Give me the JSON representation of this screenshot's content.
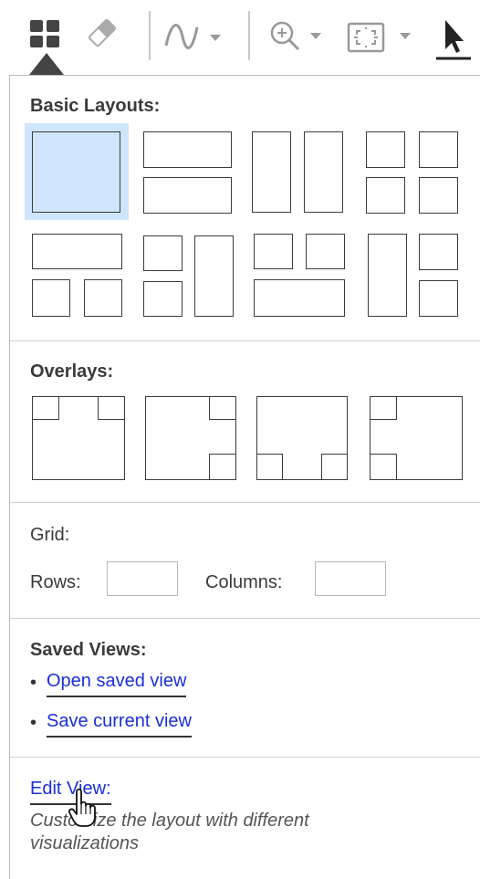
{
  "toolbar": {
    "buttons": [
      {
        "name": "layout-icon",
        "has_dropdown_pointer": true,
        "active": true
      },
      {
        "name": "eraser-icon"
      },
      {
        "name": "waveform-icon",
        "has_dropdown": true
      },
      {
        "name": "zoom-in-icon",
        "has_dropdown": true
      },
      {
        "name": "fit-view-icon",
        "has_dropdown": true
      },
      {
        "name": "select-arrow-icon"
      }
    ]
  },
  "panel": {
    "basic_layouts": {
      "heading": "Basic Layouts:"
    },
    "overlays": {
      "heading": "Overlays:"
    },
    "grid": {
      "heading": "Grid:",
      "rows_label": "Rows:",
      "columns_label": "Columns:",
      "rows_value": "",
      "columns_value": ""
    },
    "saved_views": {
      "heading": "Saved Views:",
      "bullet": "•",
      "open_label": "Open saved view",
      "save_label": "Save current view"
    },
    "edit_view": {
      "link_label": "Edit View:",
      "description": "Customize the layout with different visualizations"
    }
  },
  "colors": {
    "accent_link": "#1a2fd8",
    "selected_tile": "#cfe5fb",
    "toolbar_icon": "#444444"
  }
}
